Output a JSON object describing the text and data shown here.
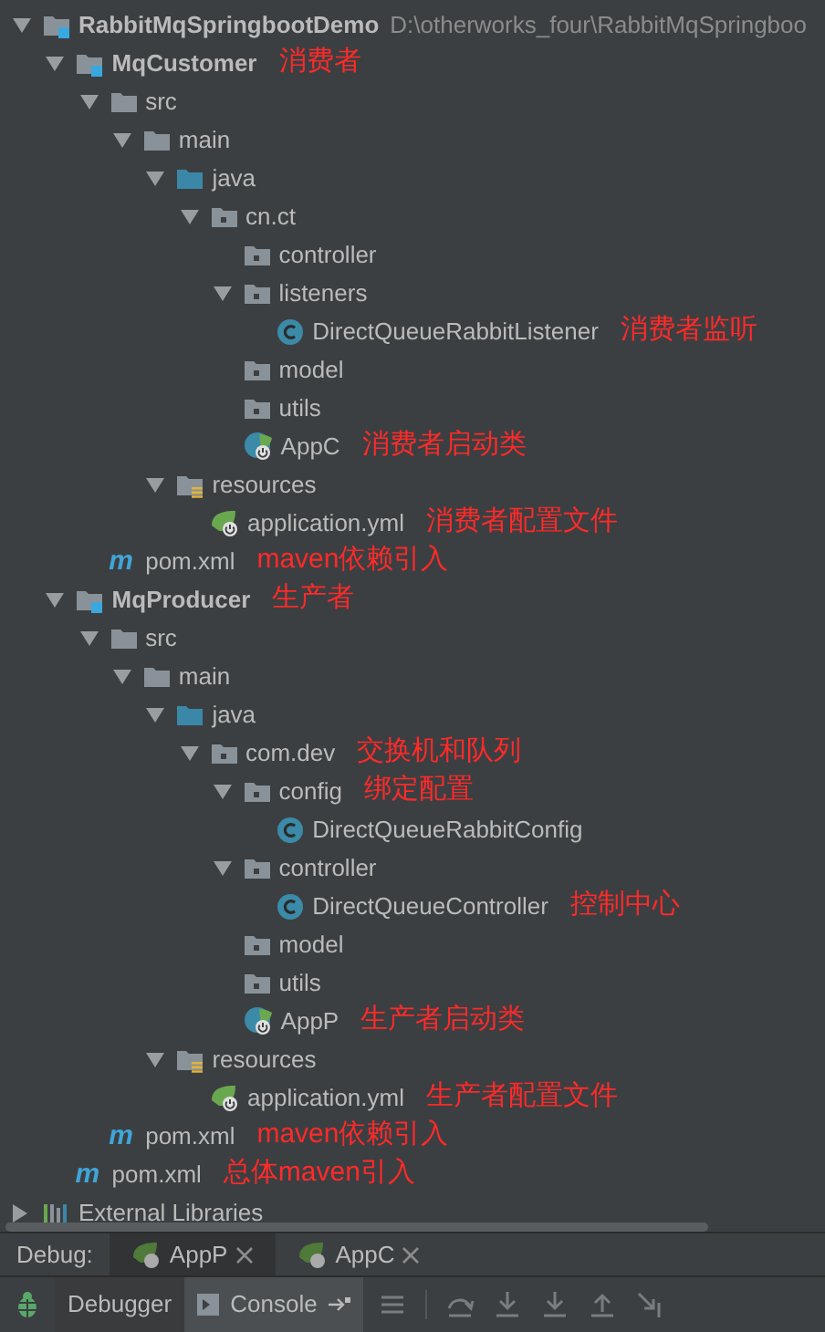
{
  "project_tree": [
    {
      "label": "RabbitMqSpringbootDemo",
      "kind": "module",
      "bold": true,
      "path": "D:\\otherworks_four\\RabbitMqSpringboo",
      "expanded": true,
      "children": [
        {
          "label": "MqCustomer",
          "kind": "module",
          "bold": true,
          "annotation": "消费者",
          "expanded": true,
          "children": [
            {
              "label": "src",
              "kind": "folder",
              "expanded": true,
              "children": [
                {
                  "label": "main",
                  "kind": "folder",
                  "expanded": true,
                  "children": [
                    {
                      "label": "java",
                      "kind": "source-folder",
                      "expanded": true,
                      "children": [
                        {
                          "label": "cn.ct",
                          "kind": "package",
                          "expanded": true,
                          "children": [
                            {
                              "label": "controller",
                              "kind": "package"
                            },
                            {
                              "label": "listeners",
                              "kind": "package",
                              "expanded": true,
                              "children": [
                                {
                                  "label": "DirectQueueRabbitListener",
                                  "kind": "class",
                                  "annotation": "消费者监听"
                                }
                              ]
                            },
                            {
                              "label": "model",
                              "kind": "package"
                            },
                            {
                              "label": "utils",
                              "kind": "package"
                            },
                            {
                              "label": "AppC",
                              "kind": "spring-class",
                              "annotation": "消费者启动类"
                            }
                          ]
                        }
                      ]
                    },
                    {
                      "label": "resources",
                      "kind": "resources-folder",
                      "expanded": true,
                      "children": [
                        {
                          "label": "application.yml",
                          "kind": "yml",
                          "annotation": "消费者配置文件"
                        }
                      ]
                    }
                  ]
                }
              ]
            },
            {
              "label": "pom.xml",
              "kind": "maven",
              "glyph": "m",
              "annotation": "maven依赖引入"
            }
          ]
        },
        {
          "label": "MqProducer",
          "kind": "module",
          "bold": true,
          "annotation": "生产者",
          "expanded": true,
          "children": [
            {
              "label": "src",
              "kind": "folder",
              "expanded": true,
              "children": [
                {
                  "label": "main",
                  "kind": "folder",
                  "expanded": true,
                  "children": [
                    {
                      "label": "java",
                      "kind": "source-folder",
                      "expanded": true,
                      "children": [
                        {
                          "label": "com.dev",
                          "kind": "package",
                          "annotation": "交换机和队列",
                          "expanded": true,
                          "children": [
                            {
                              "label": "config",
                              "kind": "package",
                              "annotation": "绑定配置",
                              "expanded": true,
                              "children": [
                                {
                                  "label": "DirectQueueRabbitConfig",
                                  "kind": "class"
                                }
                              ]
                            },
                            {
                              "label": "controller",
                              "kind": "package",
                              "expanded": true,
                              "children": [
                                {
                                  "label": "DirectQueueController",
                                  "kind": "class",
                                  "annotation": "控制中心"
                                }
                              ]
                            },
                            {
                              "label": "model",
                              "kind": "package"
                            },
                            {
                              "label": "utils",
                              "kind": "package"
                            },
                            {
                              "label": "AppP",
                              "kind": "spring-class",
                              "annotation": "生产者启动类"
                            }
                          ]
                        }
                      ]
                    },
                    {
                      "label": "resources",
                      "kind": "resources-folder",
                      "expanded": true,
                      "children": [
                        {
                          "label": "application.yml",
                          "kind": "yml",
                          "annotation": "生产者配置文件"
                        }
                      ]
                    }
                  ]
                }
              ]
            },
            {
              "label": "pom.xml",
              "kind": "maven",
              "glyph": "m",
              "annotation": "maven依赖引入"
            }
          ]
        },
        {
          "label": "pom.xml",
          "kind": "maven",
          "glyph": "m",
          "annotation": "总体maven引入"
        }
      ]
    },
    {
      "label": "External Libraries",
      "kind": "libraries",
      "expanded": false
    }
  ],
  "debug_bar": {
    "label": "Debug:",
    "tabs": [
      {
        "label": "AppP",
        "selected": true
      },
      {
        "label": "AppC",
        "selected": false
      }
    ]
  },
  "debug_toolbar": {
    "tabs": [
      {
        "label": "Debugger",
        "selected": false
      },
      {
        "label": "Console",
        "selected": true
      }
    ]
  }
}
